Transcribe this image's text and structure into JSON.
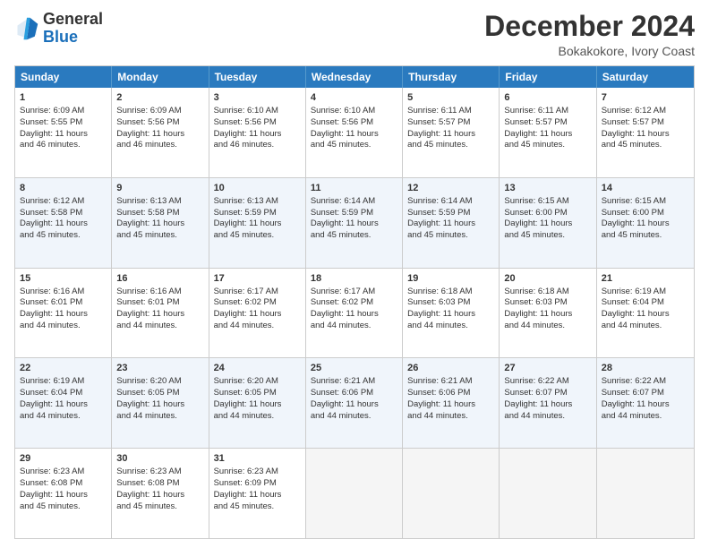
{
  "header": {
    "logo_general": "General",
    "logo_blue": "Blue",
    "month_title": "December 2024",
    "subtitle": "Bokakokore, Ivory Coast"
  },
  "days_of_week": [
    "Sunday",
    "Monday",
    "Tuesday",
    "Wednesday",
    "Thursday",
    "Friday",
    "Saturday"
  ],
  "weeks": [
    [
      {
        "day": "1",
        "lines": [
          "Sunrise: 6:09 AM",
          "Sunset: 5:55 PM",
          "Daylight: 11 hours",
          "and 46 minutes."
        ]
      },
      {
        "day": "2",
        "lines": [
          "Sunrise: 6:09 AM",
          "Sunset: 5:56 PM",
          "Daylight: 11 hours",
          "and 46 minutes."
        ]
      },
      {
        "day": "3",
        "lines": [
          "Sunrise: 6:10 AM",
          "Sunset: 5:56 PM",
          "Daylight: 11 hours",
          "and 46 minutes."
        ]
      },
      {
        "day": "4",
        "lines": [
          "Sunrise: 6:10 AM",
          "Sunset: 5:56 PM",
          "Daylight: 11 hours",
          "and 45 minutes."
        ]
      },
      {
        "day": "5",
        "lines": [
          "Sunrise: 6:11 AM",
          "Sunset: 5:57 PM",
          "Daylight: 11 hours",
          "and 45 minutes."
        ]
      },
      {
        "day": "6",
        "lines": [
          "Sunrise: 6:11 AM",
          "Sunset: 5:57 PM",
          "Daylight: 11 hours",
          "and 45 minutes."
        ]
      },
      {
        "day": "7",
        "lines": [
          "Sunrise: 6:12 AM",
          "Sunset: 5:57 PM",
          "Daylight: 11 hours",
          "and 45 minutes."
        ]
      }
    ],
    [
      {
        "day": "8",
        "lines": [
          "Sunrise: 6:12 AM",
          "Sunset: 5:58 PM",
          "Daylight: 11 hours",
          "and 45 minutes."
        ]
      },
      {
        "day": "9",
        "lines": [
          "Sunrise: 6:13 AM",
          "Sunset: 5:58 PM",
          "Daylight: 11 hours",
          "and 45 minutes."
        ]
      },
      {
        "day": "10",
        "lines": [
          "Sunrise: 6:13 AM",
          "Sunset: 5:59 PM",
          "Daylight: 11 hours",
          "and 45 minutes."
        ]
      },
      {
        "day": "11",
        "lines": [
          "Sunrise: 6:14 AM",
          "Sunset: 5:59 PM",
          "Daylight: 11 hours",
          "and 45 minutes."
        ]
      },
      {
        "day": "12",
        "lines": [
          "Sunrise: 6:14 AM",
          "Sunset: 5:59 PM",
          "Daylight: 11 hours",
          "and 45 minutes."
        ]
      },
      {
        "day": "13",
        "lines": [
          "Sunrise: 6:15 AM",
          "Sunset: 6:00 PM",
          "Daylight: 11 hours",
          "and 45 minutes."
        ]
      },
      {
        "day": "14",
        "lines": [
          "Sunrise: 6:15 AM",
          "Sunset: 6:00 PM",
          "Daylight: 11 hours",
          "and 45 minutes."
        ]
      }
    ],
    [
      {
        "day": "15",
        "lines": [
          "Sunrise: 6:16 AM",
          "Sunset: 6:01 PM",
          "Daylight: 11 hours",
          "and 44 minutes."
        ]
      },
      {
        "day": "16",
        "lines": [
          "Sunrise: 6:16 AM",
          "Sunset: 6:01 PM",
          "Daylight: 11 hours",
          "and 44 minutes."
        ]
      },
      {
        "day": "17",
        "lines": [
          "Sunrise: 6:17 AM",
          "Sunset: 6:02 PM",
          "Daylight: 11 hours",
          "and 44 minutes."
        ]
      },
      {
        "day": "18",
        "lines": [
          "Sunrise: 6:17 AM",
          "Sunset: 6:02 PM",
          "Daylight: 11 hours",
          "and 44 minutes."
        ]
      },
      {
        "day": "19",
        "lines": [
          "Sunrise: 6:18 AM",
          "Sunset: 6:03 PM",
          "Daylight: 11 hours",
          "and 44 minutes."
        ]
      },
      {
        "day": "20",
        "lines": [
          "Sunrise: 6:18 AM",
          "Sunset: 6:03 PM",
          "Daylight: 11 hours",
          "and 44 minutes."
        ]
      },
      {
        "day": "21",
        "lines": [
          "Sunrise: 6:19 AM",
          "Sunset: 6:04 PM",
          "Daylight: 11 hours",
          "and 44 minutes."
        ]
      }
    ],
    [
      {
        "day": "22",
        "lines": [
          "Sunrise: 6:19 AM",
          "Sunset: 6:04 PM",
          "Daylight: 11 hours",
          "and 44 minutes."
        ]
      },
      {
        "day": "23",
        "lines": [
          "Sunrise: 6:20 AM",
          "Sunset: 6:05 PM",
          "Daylight: 11 hours",
          "and 44 minutes."
        ]
      },
      {
        "day": "24",
        "lines": [
          "Sunrise: 6:20 AM",
          "Sunset: 6:05 PM",
          "Daylight: 11 hours",
          "and 44 minutes."
        ]
      },
      {
        "day": "25",
        "lines": [
          "Sunrise: 6:21 AM",
          "Sunset: 6:06 PM",
          "Daylight: 11 hours",
          "and 44 minutes."
        ]
      },
      {
        "day": "26",
        "lines": [
          "Sunrise: 6:21 AM",
          "Sunset: 6:06 PM",
          "Daylight: 11 hours",
          "and 44 minutes."
        ]
      },
      {
        "day": "27",
        "lines": [
          "Sunrise: 6:22 AM",
          "Sunset: 6:07 PM",
          "Daylight: 11 hours",
          "and 44 minutes."
        ]
      },
      {
        "day": "28",
        "lines": [
          "Sunrise: 6:22 AM",
          "Sunset: 6:07 PM",
          "Daylight: 11 hours",
          "and 44 minutes."
        ]
      }
    ],
    [
      {
        "day": "29",
        "lines": [
          "Sunrise: 6:23 AM",
          "Sunset: 6:08 PM",
          "Daylight: 11 hours",
          "and 45 minutes."
        ]
      },
      {
        "day": "30",
        "lines": [
          "Sunrise: 6:23 AM",
          "Sunset: 6:08 PM",
          "Daylight: 11 hours",
          "and 45 minutes."
        ]
      },
      {
        "day": "31",
        "lines": [
          "Sunrise: 6:23 AM",
          "Sunset: 6:09 PM",
          "Daylight: 11 hours",
          "and 45 minutes."
        ]
      },
      {
        "day": "",
        "lines": []
      },
      {
        "day": "",
        "lines": []
      },
      {
        "day": "",
        "lines": []
      },
      {
        "day": "",
        "lines": []
      }
    ]
  ]
}
